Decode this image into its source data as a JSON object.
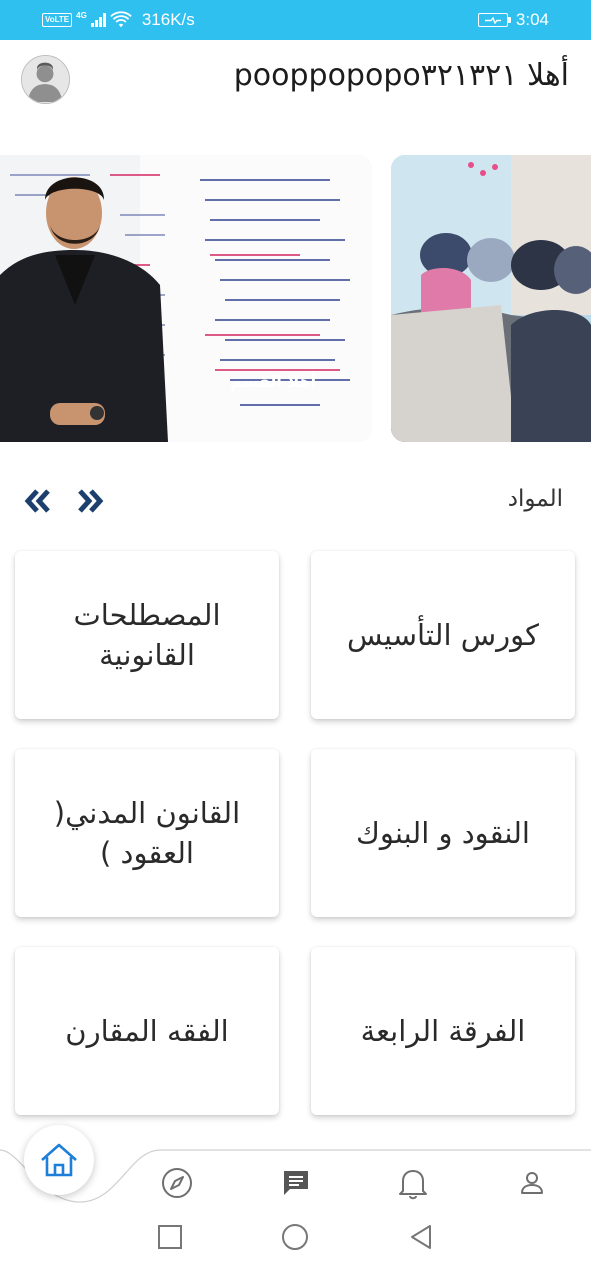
{
  "status_bar": {
    "volte": "VoLTE",
    "network": "4G",
    "speed": "316K/s",
    "time": "3:04",
    "color": "#2fc0ef"
  },
  "header": {
    "greeting": "أهلا pooppopopo٣٢١٣٢١",
    "avatar_icon": "user-avatar-icon"
  },
  "banner": {
    "slides": [
      {
        "caption": "أهلا القسم",
        "icon": "teacher-whiteboard-photo"
      },
      {
        "icon": "students-classroom-photo"
      }
    ]
  },
  "subjects": {
    "title": "المواد",
    "prev_icon": "double-chevron-left-icon",
    "next_icon": "double-chevron-right-icon",
    "items": [
      {
        "label": "كورس التأسيس"
      },
      {
        "label": "المصطلحات القانونية"
      },
      {
        "label": "النقود و البنوك"
      },
      {
        "label": "القانون المدني( العقود )"
      },
      {
        "label": "الفرقة الرابعة"
      },
      {
        "label": "الفقه المقارن"
      }
    ]
  },
  "bottom_nav": {
    "accent": "#1e7fd8",
    "items": [
      {
        "icon": "home-icon"
      },
      {
        "icon": "compass-icon"
      },
      {
        "icon": "chat-icon"
      },
      {
        "icon": "bell-icon"
      },
      {
        "icon": "profile-icon"
      }
    ]
  },
  "system_nav": {
    "items": [
      {
        "icon": "recent-apps-square-icon"
      },
      {
        "icon": "home-circle-icon"
      },
      {
        "icon": "back-triangle-icon"
      }
    ]
  }
}
